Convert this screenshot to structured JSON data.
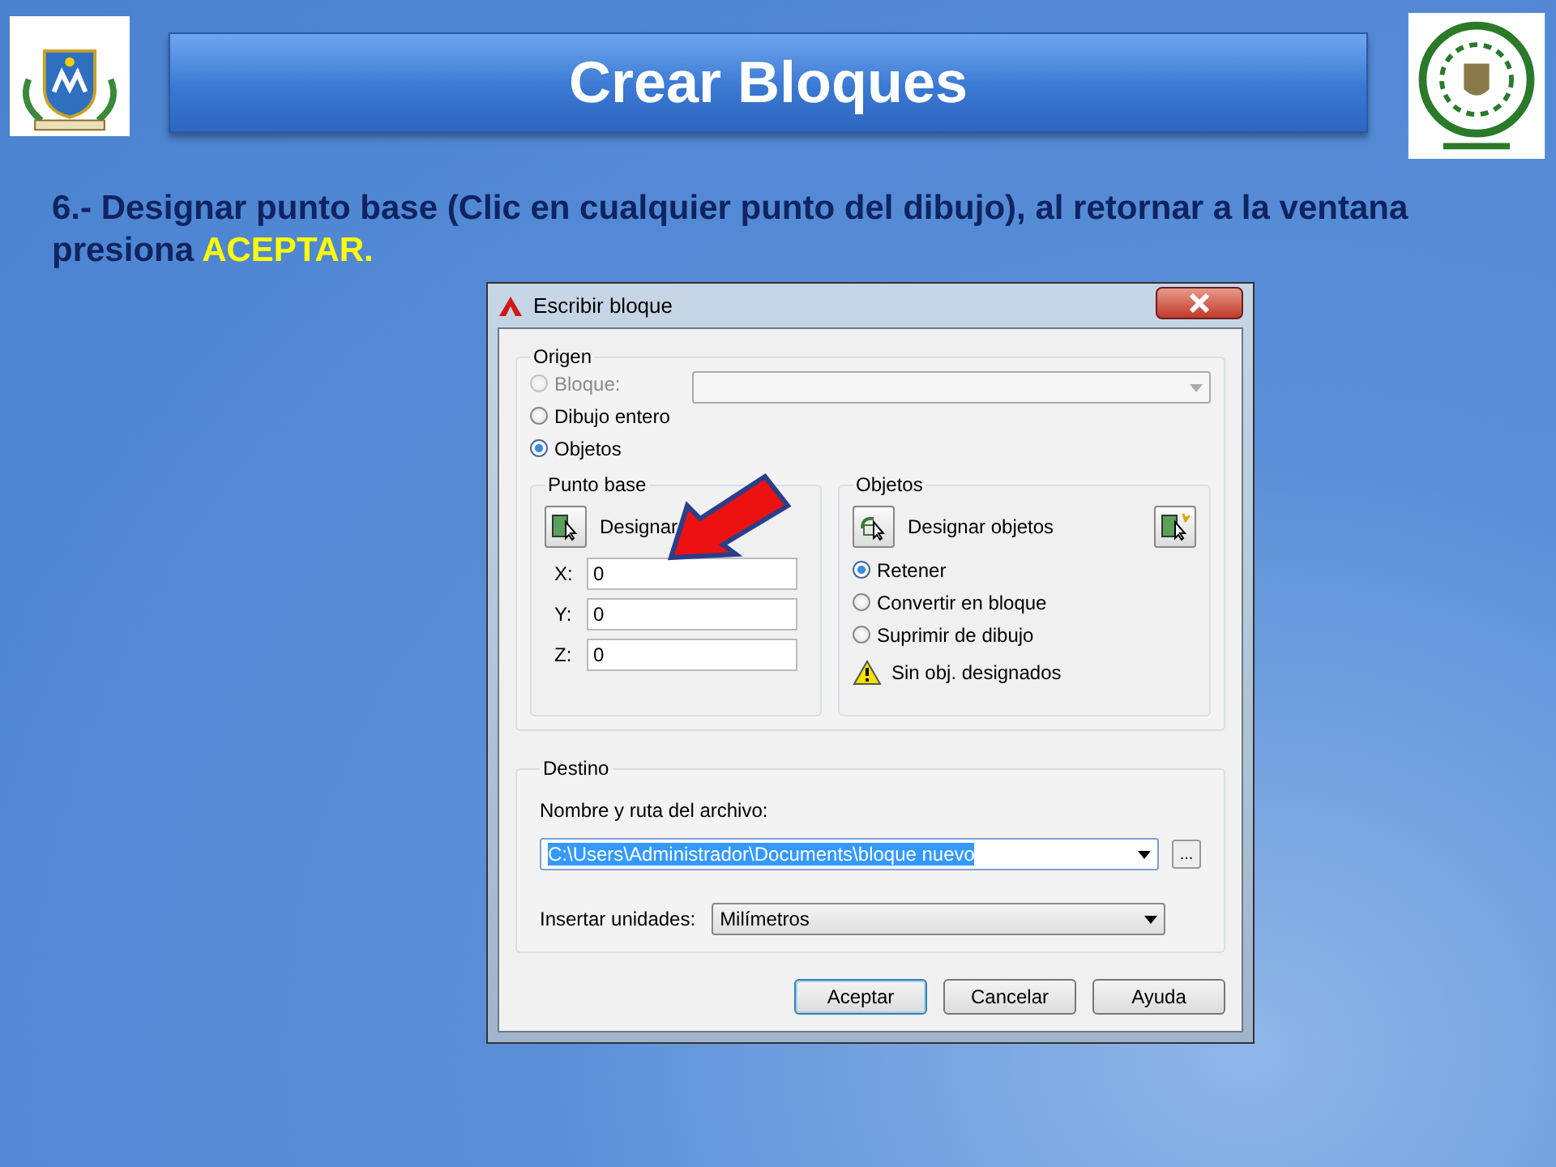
{
  "slide": {
    "title": "Crear Bloques",
    "instruction": "6.- Designar punto base (Clic en cualquier punto del dibujo), al retornar a la ventana presiona",
    "highlight": "ACEPTAR."
  },
  "dialog": {
    "title": "Escribir bloque",
    "origin": {
      "label": "Origen",
      "options": [
        {
          "label": "Bloque:",
          "selected": false,
          "disabled": true
        },
        {
          "label": "Dibujo entero",
          "selected": false,
          "disabled": false
        },
        {
          "label": "Objetos",
          "selected": true,
          "disabled": false
        }
      ]
    },
    "base_point": {
      "label": "Punto base",
      "button": "Designar",
      "coords": [
        {
          "label": "X:",
          "value": "0"
        },
        {
          "label": "Y:",
          "value": "0"
        },
        {
          "label": "Z:",
          "value": "0"
        }
      ]
    },
    "objects": {
      "label": "Objetos",
      "button": "Designar objetos",
      "options": [
        {
          "label": "Retener",
          "selected": true
        },
        {
          "label": "Convertir en bloque",
          "selected": false
        },
        {
          "label": "Suprimir de dibujo",
          "selected": false
        }
      ],
      "warning": "Sin obj. designados"
    },
    "destination": {
      "label": "Destino",
      "file_label": "Nombre y ruta del archivo:",
      "file_path": "C:\\Users\\Administrador\\Documents\\bloque nuevo",
      "browse": "...",
      "units_label": "Insertar unidades:",
      "units": "Milímetros"
    },
    "buttons": [
      {
        "label": "Aceptar",
        "default": true
      },
      {
        "label": "Cancelar",
        "default": false
      },
      {
        "label": "Ayuda",
        "default": false
      }
    ]
  }
}
